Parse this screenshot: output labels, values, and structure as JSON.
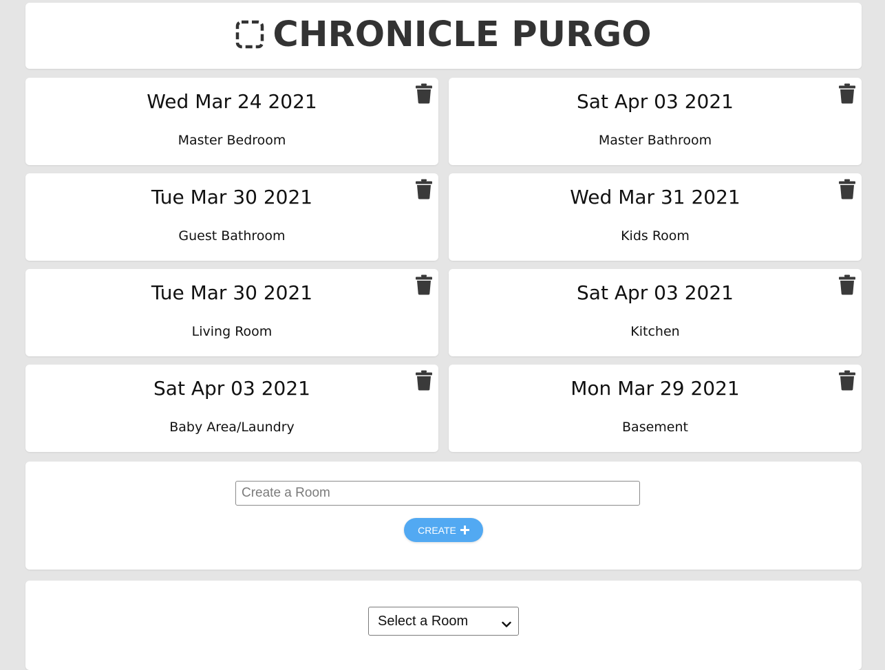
{
  "header": {
    "title": "CHRONICLE PURGO",
    "logo_icon": "dashed-square-icon"
  },
  "rooms": [
    {
      "date": "Wed Mar 24 2021",
      "name": "Master Bedroom"
    },
    {
      "date": "Sat Apr 03 2021",
      "name": "Master Bathroom"
    },
    {
      "date": "Tue Mar 30 2021",
      "name": "Guest Bathroom"
    },
    {
      "date": "Wed Mar 31 2021",
      "name": "Kids Room"
    },
    {
      "date": "Tue Mar 30 2021",
      "name": "Living Room"
    },
    {
      "date": "Sat Apr 03 2021",
      "name": "Kitchen"
    },
    {
      "date": "Sat Apr 03 2021",
      "name": "Baby Area/Laundry"
    },
    {
      "date": "Mon Mar 29 2021",
      "name": "Basement"
    }
  ],
  "create": {
    "placeholder": "Create a Room",
    "value": "",
    "button_label": "CREATE"
  },
  "select": {
    "selected": "Select a Room"
  },
  "colors": {
    "background": "#e5e5e5",
    "panel": "#ffffff",
    "accent": "#52a9f2",
    "title": "#333333",
    "icon": "#3a3a3a"
  }
}
